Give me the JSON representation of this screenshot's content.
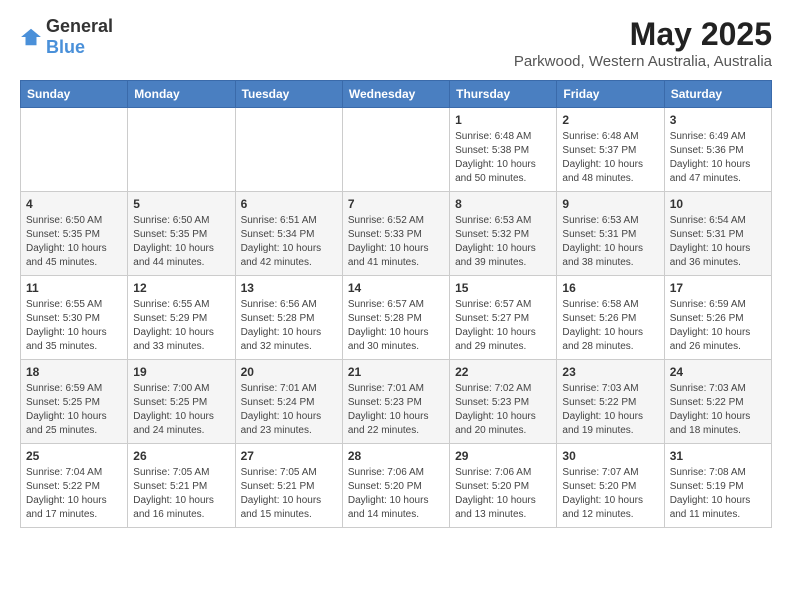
{
  "logo": {
    "general": "General",
    "blue": "Blue"
  },
  "title": "May 2025",
  "subtitle": "Parkwood, Western Australia, Australia",
  "days_of_week": [
    "Sunday",
    "Monday",
    "Tuesday",
    "Wednesday",
    "Thursday",
    "Friday",
    "Saturday"
  ],
  "weeks": [
    [
      {
        "day": "",
        "info": ""
      },
      {
        "day": "",
        "info": ""
      },
      {
        "day": "",
        "info": ""
      },
      {
        "day": "",
        "info": ""
      },
      {
        "day": "1",
        "info": "Sunrise: 6:48 AM\nSunset: 5:38 PM\nDaylight: 10 hours\nand 50 minutes."
      },
      {
        "day": "2",
        "info": "Sunrise: 6:48 AM\nSunset: 5:37 PM\nDaylight: 10 hours\nand 48 minutes."
      },
      {
        "day": "3",
        "info": "Sunrise: 6:49 AM\nSunset: 5:36 PM\nDaylight: 10 hours\nand 47 minutes."
      }
    ],
    [
      {
        "day": "4",
        "info": "Sunrise: 6:50 AM\nSunset: 5:35 PM\nDaylight: 10 hours\nand 45 minutes."
      },
      {
        "day": "5",
        "info": "Sunrise: 6:50 AM\nSunset: 5:35 PM\nDaylight: 10 hours\nand 44 minutes."
      },
      {
        "day": "6",
        "info": "Sunrise: 6:51 AM\nSunset: 5:34 PM\nDaylight: 10 hours\nand 42 minutes."
      },
      {
        "day": "7",
        "info": "Sunrise: 6:52 AM\nSunset: 5:33 PM\nDaylight: 10 hours\nand 41 minutes."
      },
      {
        "day": "8",
        "info": "Sunrise: 6:53 AM\nSunset: 5:32 PM\nDaylight: 10 hours\nand 39 minutes."
      },
      {
        "day": "9",
        "info": "Sunrise: 6:53 AM\nSunset: 5:31 PM\nDaylight: 10 hours\nand 38 minutes."
      },
      {
        "day": "10",
        "info": "Sunrise: 6:54 AM\nSunset: 5:31 PM\nDaylight: 10 hours\nand 36 minutes."
      }
    ],
    [
      {
        "day": "11",
        "info": "Sunrise: 6:55 AM\nSunset: 5:30 PM\nDaylight: 10 hours\nand 35 minutes."
      },
      {
        "day": "12",
        "info": "Sunrise: 6:55 AM\nSunset: 5:29 PM\nDaylight: 10 hours\nand 33 minutes."
      },
      {
        "day": "13",
        "info": "Sunrise: 6:56 AM\nSunset: 5:28 PM\nDaylight: 10 hours\nand 32 minutes."
      },
      {
        "day": "14",
        "info": "Sunrise: 6:57 AM\nSunset: 5:28 PM\nDaylight: 10 hours\nand 30 minutes."
      },
      {
        "day": "15",
        "info": "Sunrise: 6:57 AM\nSunset: 5:27 PM\nDaylight: 10 hours\nand 29 minutes."
      },
      {
        "day": "16",
        "info": "Sunrise: 6:58 AM\nSunset: 5:26 PM\nDaylight: 10 hours\nand 28 minutes."
      },
      {
        "day": "17",
        "info": "Sunrise: 6:59 AM\nSunset: 5:26 PM\nDaylight: 10 hours\nand 26 minutes."
      }
    ],
    [
      {
        "day": "18",
        "info": "Sunrise: 6:59 AM\nSunset: 5:25 PM\nDaylight: 10 hours\nand 25 minutes."
      },
      {
        "day": "19",
        "info": "Sunrise: 7:00 AM\nSunset: 5:25 PM\nDaylight: 10 hours\nand 24 minutes."
      },
      {
        "day": "20",
        "info": "Sunrise: 7:01 AM\nSunset: 5:24 PM\nDaylight: 10 hours\nand 23 minutes."
      },
      {
        "day": "21",
        "info": "Sunrise: 7:01 AM\nSunset: 5:23 PM\nDaylight: 10 hours\nand 22 minutes."
      },
      {
        "day": "22",
        "info": "Sunrise: 7:02 AM\nSunset: 5:23 PM\nDaylight: 10 hours\nand 20 minutes."
      },
      {
        "day": "23",
        "info": "Sunrise: 7:03 AM\nSunset: 5:22 PM\nDaylight: 10 hours\nand 19 minutes."
      },
      {
        "day": "24",
        "info": "Sunrise: 7:03 AM\nSunset: 5:22 PM\nDaylight: 10 hours\nand 18 minutes."
      }
    ],
    [
      {
        "day": "25",
        "info": "Sunrise: 7:04 AM\nSunset: 5:22 PM\nDaylight: 10 hours\nand 17 minutes."
      },
      {
        "day": "26",
        "info": "Sunrise: 7:05 AM\nSunset: 5:21 PM\nDaylight: 10 hours\nand 16 minutes."
      },
      {
        "day": "27",
        "info": "Sunrise: 7:05 AM\nSunset: 5:21 PM\nDaylight: 10 hours\nand 15 minutes."
      },
      {
        "day": "28",
        "info": "Sunrise: 7:06 AM\nSunset: 5:20 PM\nDaylight: 10 hours\nand 14 minutes."
      },
      {
        "day": "29",
        "info": "Sunrise: 7:06 AM\nSunset: 5:20 PM\nDaylight: 10 hours\nand 13 minutes."
      },
      {
        "day": "30",
        "info": "Sunrise: 7:07 AM\nSunset: 5:20 PM\nDaylight: 10 hours\nand 12 minutes."
      },
      {
        "day": "31",
        "info": "Sunrise: 7:08 AM\nSunset: 5:19 PM\nDaylight: 10 hours\nand 11 minutes."
      }
    ]
  ]
}
